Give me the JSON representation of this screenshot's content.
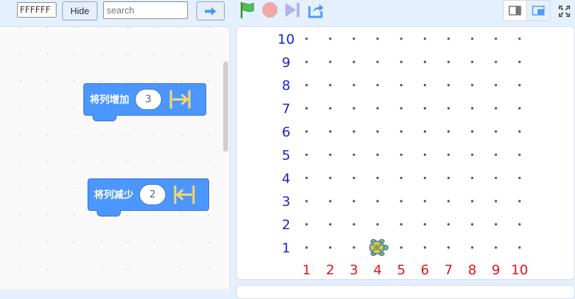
{
  "toolbar": {
    "color_value": "FFFFFF",
    "hide_label": "Hide",
    "search_placeholder": "search"
  },
  "palette": {
    "blocks": [
      {
        "label": "将列增加",
        "value": "3"
      },
      {
        "label": "将列减少",
        "value": "2"
      }
    ]
  },
  "stage": {
    "y_labels": [
      "10",
      "9",
      "8",
      "7",
      "6",
      "5",
      "4",
      "3",
      "2",
      "1"
    ],
    "x_labels": [
      "1",
      "2",
      "3",
      "4",
      "5",
      "6",
      "7",
      "8",
      "9",
      "10"
    ],
    "sprite": {
      "name": "turtle",
      "col": 4,
      "row": 1
    },
    "colors": {
      "y_axis": "#1a22cf",
      "x_axis": "#e0141a",
      "dots": "#555555"
    }
  }
}
